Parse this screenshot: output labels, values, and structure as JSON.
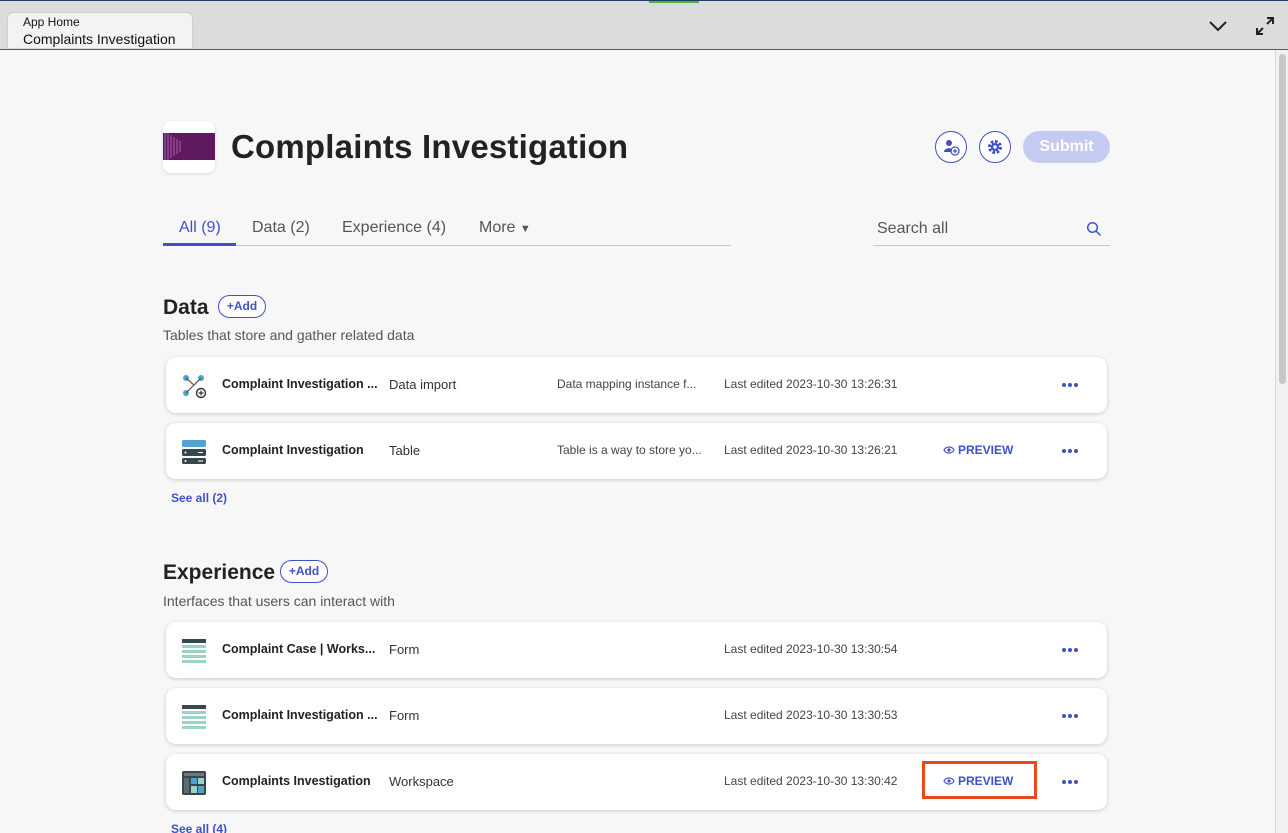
{
  "window": {
    "tab_subtitle": "App Home",
    "tab_title": "Complaints Investigation",
    "icons": [
      "chevron-down-icon",
      "expand-icon"
    ]
  },
  "header": {
    "title": "Complaints Investigation",
    "submit_label": "Submit",
    "icons": [
      "add-user-icon",
      "gear-icon"
    ]
  },
  "tabs": [
    {
      "label": "All (9)"
    },
    {
      "label": "Data (2)"
    },
    {
      "label": "Experience (4)"
    },
    {
      "label": "More"
    }
  ],
  "search": {
    "placeholder": "Search all"
  },
  "sections": {
    "data": {
      "title": "Data",
      "add_label": "+Add",
      "subtitle": "Tables that store and gather related data",
      "see_all": "See all (2)",
      "rows": [
        {
          "name": "Complaint Investigation ...",
          "type": "Data import",
          "description": "Data mapping instance f...",
          "edited": "Last edited 2023-10-30 13:26:31",
          "preview": ""
        },
        {
          "name": "Complaint Investigation",
          "type": "Table",
          "description": "Table is a way to store yo...",
          "edited": "Last edited 2023-10-30 13:26:21",
          "preview": "PREVIEW"
        }
      ]
    },
    "experience": {
      "title": "Experience",
      "add_label": "+Add",
      "subtitle": "Interfaces that users can interact with",
      "see_all": "See all (4)",
      "rows": [
        {
          "name": "Complaint Case | Works...",
          "type": "Form",
          "description": "",
          "edited": "Last edited 2023-10-30 13:30:54",
          "preview": ""
        },
        {
          "name": "Complaint Investigation ...",
          "type": "Form",
          "description": "",
          "edited": "Last edited 2023-10-30 13:30:53",
          "preview": ""
        },
        {
          "name": "Complaints Investigation",
          "type": "Workspace",
          "description": "",
          "edited": "Last edited 2023-10-30 13:30:42",
          "preview": "PREVIEW"
        }
      ]
    }
  },
  "colors": {
    "accent": "#3f51c8",
    "highlight": "#e8491d",
    "logo": "#5e1a5e"
  }
}
